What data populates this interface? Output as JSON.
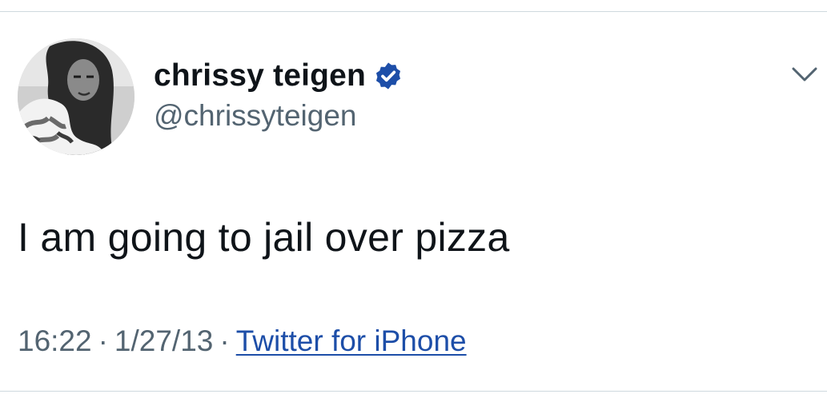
{
  "user": {
    "display_name": "chrissy teigen",
    "handle": "@chrissyteigen",
    "verified": true,
    "avatar_icon": "profile-photo"
  },
  "tweet": {
    "text": "I am going to jail over pizza",
    "time": "16:22",
    "separator": "·",
    "date": "1/27/13",
    "source": "Twitter for iPhone"
  },
  "icons": {
    "verified": "verified-badge-icon",
    "more": "chevron-down-icon"
  },
  "colors": {
    "text": "#0f1419",
    "secondary": "#536471",
    "link": "#1d4ea8",
    "verified": "#1d4ea8",
    "divider": "#cfd9de"
  }
}
